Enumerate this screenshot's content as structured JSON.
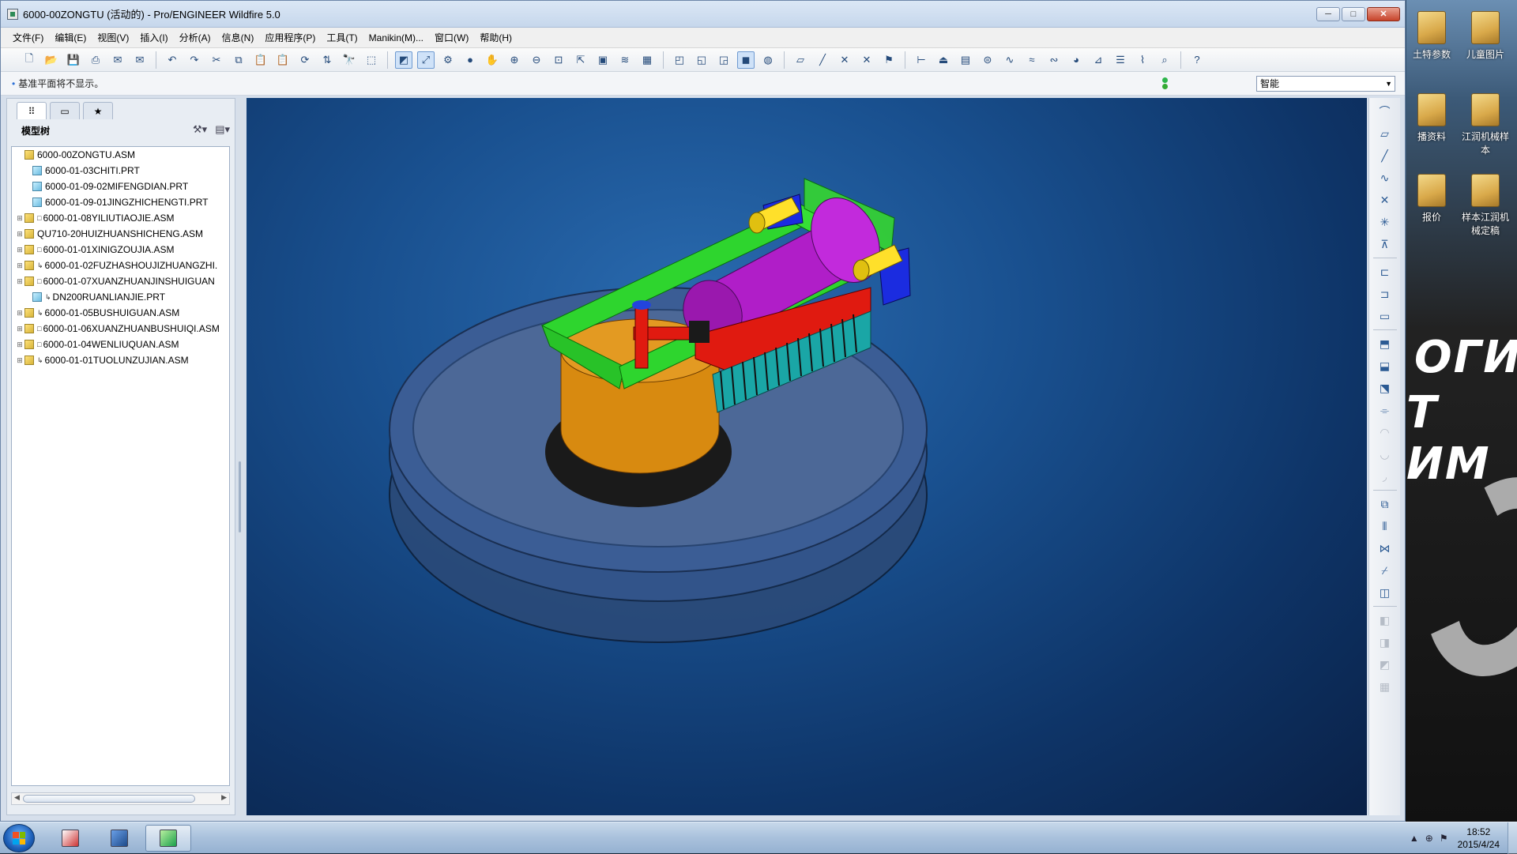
{
  "window": {
    "title": "6000-00ZONGTU (活动的) - Pro/ENGINEER Wildfire 5.0",
    "minimize": "─",
    "maximize": "□",
    "close": "✕"
  },
  "menu": [
    "文件(F)",
    "编辑(E)",
    "视图(V)",
    "插入(I)",
    "分析(A)",
    "信息(N)",
    "应用程序(P)",
    "工具(T)",
    "Manikin(M)...",
    "窗口(W)",
    "帮助(H)"
  ],
  "status": {
    "message": "基准平面将不显示。",
    "select_filter": "智能"
  },
  "panel": {
    "tree_label": "模型树",
    "tree_items": [
      {
        "label": "6000-00ZONGTU.ASM",
        "type": "asm",
        "level": 0,
        "expandable": false,
        "flag": ""
      },
      {
        "label": "6000-01-03CHITI.PRT",
        "type": "prt",
        "level": 1,
        "expandable": false,
        "flag": ""
      },
      {
        "label": "6000-01-09-02MIFENGDIAN.PRT",
        "type": "prt",
        "level": 1,
        "expandable": false,
        "flag": ""
      },
      {
        "label": "6000-01-09-01JINGZHICHENGTI.PRT",
        "type": "prt",
        "level": 1,
        "expandable": false,
        "flag": ""
      },
      {
        "label": "6000-01-08YILIUTIAOJIE.ASM",
        "type": "asm",
        "level": 1,
        "expandable": true,
        "flag": "□"
      },
      {
        "label": "QU710-20HUIZHUANSHICHENG.ASM",
        "type": "asm",
        "level": 1,
        "expandable": true,
        "flag": ""
      },
      {
        "label": "6000-01-01XINIGZOUJIA.ASM",
        "type": "asm",
        "level": 1,
        "expandable": true,
        "flag": "□"
      },
      {
        "label": "6000-01-02FUZHASHOUJIZHUANGZHI.",
        "type": "asm",
        "level": 1,
        "expandable": true,
        "flag": "↳"
      },
      {
        "label": "6000-01-07XUANZHUANJINSHUIGUAN",
        "type": "asm",
        "level": 1,
        "expandable": true,
        "flag": "□"
      },
      {
        "label": "DN200RUANLIANJIE.PRT",
        "type": "prt",
        "level": 1,
        "expandable": false,
        "flag": "↳"
      },
      {
        "label": "6000-01-05BUSHUIGUAN.ASM",
        "type": "asm",
        "level": 1,
        "expandable": true,
        "flag": "↳"
      },
      {
        "label": "6000-01-06XUANZHUANBUSHUIQI.ASM",
        "type": "asm",
        "level": 1,
        "expandable": true,
        "flag": "□"
      },
      {
        "label": "6000-01-04WENLIUQUAN.ASM",
        "type": "asm",
        "level": 1,
        "expandable": true,
        "flag": "□"
      },
      {
        "label": "6000-01-01TUOLUNZUJIAN.ASM",
        "type": "asm",
        "level": 1,
        "expandable": true,
        "flag": "↳"
      }
    ]
  },
  "desktop": {
    "icons": [
      {
        "label": "土特参数"
      },
      {
        "label": "儿童图片"
      },
      {
        "label": "播资料"
      },
      {
        "label": "江润机械样本"
      },
      {
        "label": "报价"
      },
      {
        "label": "样本江润机械定稿"
      }
    ],
    "wallpaper_text_1": "ОГИ",
    "wallpaper_text_2": "Т ИМ"
  },
  "taskbar": {
    "time": "18:52",
    "date": "2015/4/24"
  },
  "colors": {
    "accent": "#2a6fd6",
    "viewport_bg": "#0e3467"
  }
}
